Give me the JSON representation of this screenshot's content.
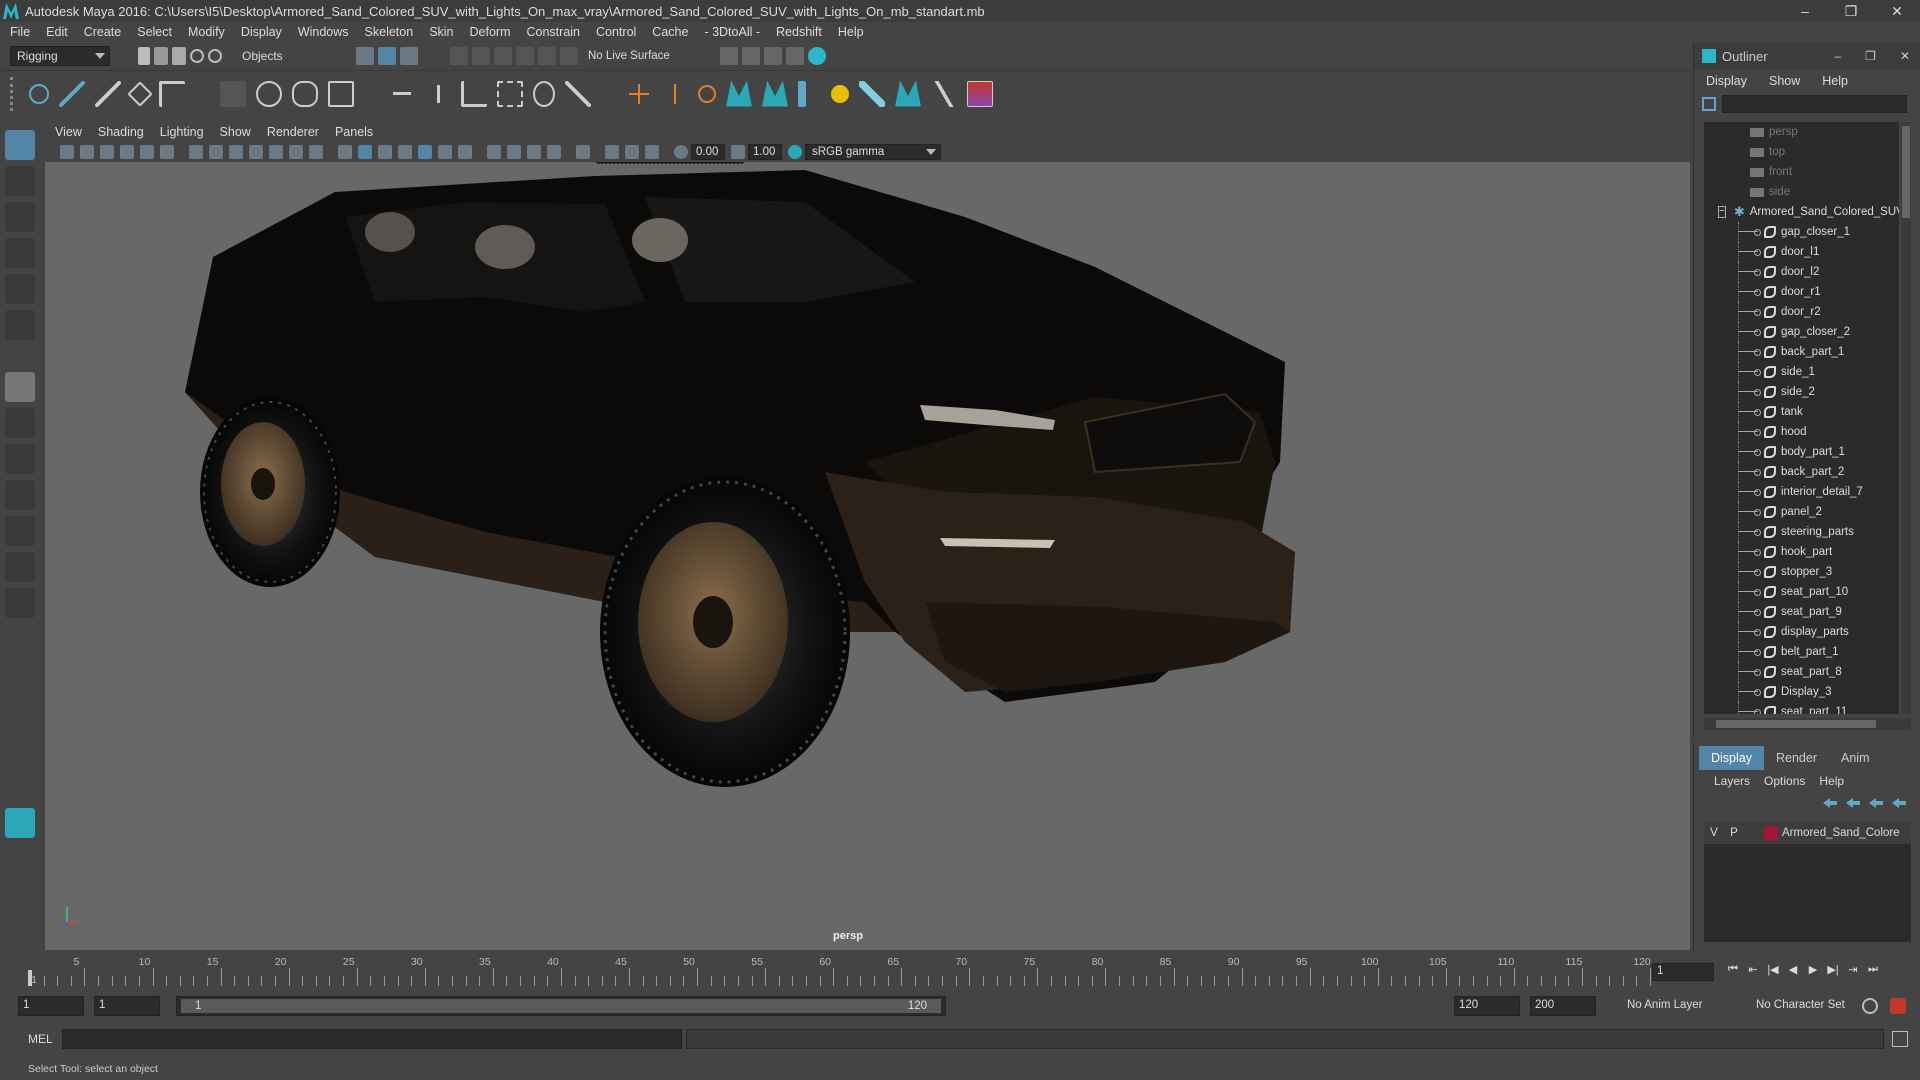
{
  "window": {
    "title": "Autodesk Maya 2016: C:\\Users\\I5\\Desktop\\Armored_Sand_Colored_SUV_with_Lights_On_max_vray\\Armored_Sand_Colored_SUV_with_Lights_On_mb_standart.mb",
    "minimize": "–",
    "restore": "❐",
    "close": "✕"
  },
  "menubar": [
    "File",
    "Edit",
    "Create",
    "Select",
    "Modify",
    "Display",
    "Windows",
    "Skeleton",
    "Skin",
    "Deform",
    "Constrain",
    "Control",
    "Cache",
    "- 3DtoAll -",
    "Redshift",
    "Help"
  ],
  "statusline": {
    "menuset": "Rigging",
    "selection_mode": "Objects",
    "live_surface": "No Live Surface"
  },
  "panel": {
    "menus": [
      "View",
      "Shading",
      "Lighting",
      "Show",
      "Renderer",
      "Panels"
    ],
    "exposure": "0.00",
    "gamma": "1.00",
    "color_space": "sRGB gamma",
    "camera_label": "persp"
  },
  "outliner": {
    "title": "Outliner",
    "menus": [
      "Display",
      "Show",
      "Help"
    ],
    "cameras": [
      "persp",
      "top",
      "front",
      "side"
    ],
    "group": "Armored_Sand_Colored_SUV",
    "group_toggle": "−",
    "children": [
      "gap_closer_1",
      "door_l1",
      "door_l2",
      "door_r1",
      "door_r2",
      "gap_closer_2",
      "back_part_1",
      "side_1",
      "side_2",
      "tank",
      "hood",
      "body_part_1",
      "back_part_2",
      "interior_detail_7",
      "panel_2",
      "steering_parts",
      "hook_part",
      "stopper_3",
      "seat_part_10",
      "seat_part_9",
      "display_parts",
      "belt_part_1",
      "seat_part_8",
      "Display_3",
      "seat_part_11"
    ]
  },
  "layers": {
    "tabs": [
      "Display",
      "Render",
      "Anim"
    ],
    "menus": [
      "Layers",
      "Options",
      "Help"
    ],
    "rows": [
      {
        "v": "V",
        "p": "P",
        "name": "Armored_Sand_Colore",
        "color": "#a3143a"
      }
    ]
  },
  "timeline": {
    "ticks": [
      5,
      10,
      15,
      20,
      25,
      30,
      35,
      40,
      45,
      50,
      55,
      60,
      65,
      70,
      75,
      80,
      85,
      90,
      95,
      100,
      105,
      110,
      115,
      120
    ],
    "start_tick_label": "1",
    "current_frame": "1",
    "max_frame": 120,
    "playback_buttons": [
      "⏮",
      "⇤",
      "|◀",
      "◀",
      "▶",
      "▶|",
      "⇥",
      "⏭"
    ]
  },
  "range": {
    "start": "1",
    "playback_start": "1",
    "range_start_label": "1",
    "range_end_label": "120",
    "playback_end": "120",
    "end": "200",
    "anim_layer": "No Anim Layer",
    "character_set": "No Character Set"
  },
  "cmdline": {
    "label": "MEL",
    "help": "Select Tool: select an object"
  },
  "colors": {
    "accent": "#5285a6",
    "layer_color": "#a3143a",
    "viewport_bg": "#686868"
  }
}
